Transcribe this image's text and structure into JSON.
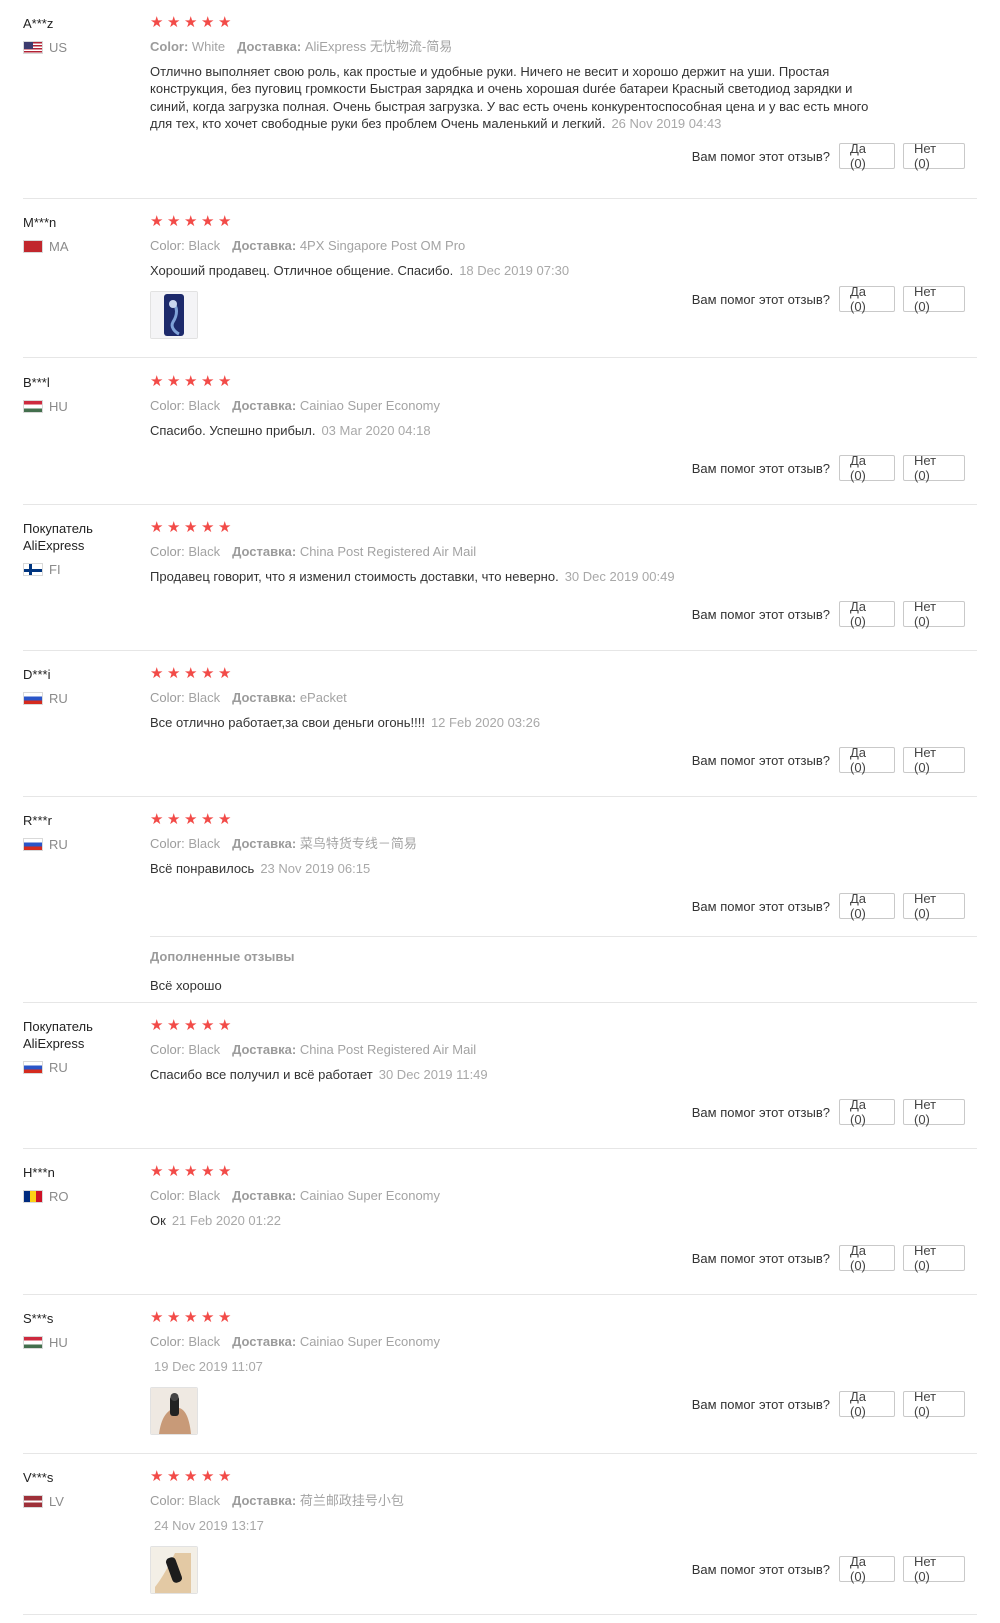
{
  "helpful_question": "Вам помог этот отзыв?",
  "colors": {
    "stars": "#f24b48",
    "muted": "#9b9b9b",
    "text": "#333333",
    "border": "#c9c9c9"
  },
  "reviews": [
    {
      "user": "A***z",
      "country": "US",
      "flag": "us-flag-icon",
      "rating": 5,
      "color_label": "Color:",
      "color": "White",
      "delivery_label": "Доставка:",
      "delivery": "AliExpress 无忧物流-简易",
      "text": "Отлично выполняет свою роль, как простые и удобные руки. Ничего не весит и хорошо держит на уши. Простая конструкция, без пуговиц громкости Быстрая зарядка и очень хорошая durée батареи Красный светодиод зарядки и синий, когда загрузка полная. Очень быстрая загрузка. У вас есть очень конкурентоспособная цена и у вас есть много для тех, кто хочет свободные руки без проблем Очень маленький и легкий.",
      "date": "26 Nov 2019 04:43",
      "yes_label": "Да (0)",
      "no_label": "Нет (0)"
    },
    {
      "user": "M***n",
      "country": "MA",
      "flag": "ma-flag-icon",
      "rating": 5,
      "color_label": "Color:",
      "color": "Black",
      "delivery_label": "Доставка:",
      "delivery": "4PX Singapore Post OM Pro",
      "text": "Хороший продавец. Отличное общение. Спасибо.",
      "date": "18 Dec 2019 07:30",
      "photo": "review-photo-earphone-blue",
      "yes_label": "Да (0)",
      "no_label": "Нет (0)"
    },
    {
      "user": "B***l",
      "country": "HU",
      "flag": "hu-flag-icon",
      "rating": 5,
      "color_label": "Color:",
      "color": "Black",
      "delivery_label": "Доставка:",
      "delivery": "Cainiao Super Economy",
      "text": "Спасибо. Успешно прибыл.",
      "date": "03 Mar 2020 04:18",
      "yes_label": "Да (0)",
      "no_label": "Нет (0)"
    },
    {
      "user": "Покупатель AliExpress",
      "country": "FI",
      "flag": "fi-flag-icon",
      "rating": 5,
      "color_label": "Color:",
      "color": "Black",
      "delivery_label": "Доставка:",
      "delivery": "China Post Registered Air Mail",
      "text": "Продавец говорит, что я изменил стоимость доставки, что неверно.",
      "date": "30 Dec 2019 00:49",
      "yes_label": "Да (0)",
      "no_label": "Нет (0)"
    },
    {
      "user": "D***i",
      "country": "RU",
      "flag": "ru-flag-icon",
      "rating": 5,
      "color_label": "Color:",
      "color": "Black",
      "delivery_label": "Доставка:",
      "delivery": "ePacket",
      "text": "Все отлично работает,за свои деньги огонь!!!!",
      "date": "12 Feb 2020 03:26",
      "yes_label": "Да (0)",
      "no_label": "Нет (0)"
    },
    {
      "user": "R***r",
      "country": "RU",
      "flag": "ru-flag-icon",
      "rating": 5,
      "color_label": "Color:",
      "color": "Black",
      "delivery_label": "Доставка:",
      "delivery": "菜鸟特货专线－简易",
      "text": "Всё понравилось",
      "date": "23 Nov 2019 06:15",
      "yes_label": "Да (0)",
      "no_label": "Нет (0)",
      "additional_title": "Дополненные отзывы",
      "additional_text": "Всё хорошо"
    },
    {
      "user": "Покупатель AliExpress",
      "country": "RU",
      "flag": "ru-flag-icon",
      "rating": 5,
      "color_label": "Color:",
      "color": "Black",
      "delivery_label": "Доставка:",
      "delivery": "China Post Registered Air Mail",
      "text": "Спасибо все получил и всё работает",
      "date": "30 Dec 2019 11:49",
      "yes_label": "Да (0)",
      "no_label": "Нет (0)"
    },
    {
      "user": "H***n",
      "country": "RO",
      "flag": "ro-flag-icon",
      "rating": 5,
      "color_label": "Color:",
      "color": "Black",
      "delivery_label": "Доставка:",
      "delivery": "Cainiao Super Economy",
      "text": "Ок",
      "date": "21 Feb 2020 01:22",
      "yes_label": "Да (0)",
      "no_label": "Нет (0)"
    },
    {
      "user": "S***s",
      "country": "HU",
      "flag": "hu-flag-icon",
      "rating": 5,
      "color_label": "Color:",
      "color": "Black",
      "delivery_label": "Доставка:",
      "delivery": "Cainiao Super Economy",
      "text": "",
      "date": "19 Dec 2019 11:07",
      "photo": "review-photo-earphone-hand",
      "yes_label": "Да (0)",
      "no_label": "Нет (0)"
    },
    {
      "user": "V***s",
      "country": "LV",
      "flag": "lv-flag-icon",
      "rating": 5,
      "color_label": "Color:",
      "color": "Black",
      "delivery_label": "Доставка:",
      "delivery": "荷兰邮政挂号小包",
      "text": "",
      "date": "24 Nov 2019 13:17",
      "photo": "review-photo-earphone-black",
      "yes_label": "Да (0)",
      "no_label": "Нет (0)"
    }
  ]
}
